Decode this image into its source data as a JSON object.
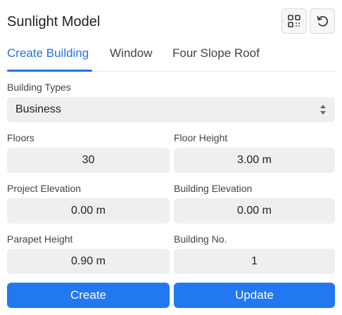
{
  "header": {
    "title": "Sunlight Model",
    "icons": [
      "qr-grid-icon",
      "reset-icon"
    ]
  },
  "tabs": [
    {
      "label": "Create Building",
      "active": true
    },
    {
      "label": "Window",
      "active": false
    },
    {
      "label": "Four Slope Roof",
      "active": false
    }
  ],
  "form": {
    "building_types": {
      "label": "Building Types",
      "value": "Business"
    },
    "floors": {
      "label": "Floors",
      "value": "30"
    },
    "floor_height": {
      "label": "Floor Height",
      "value": "3.00 m"
    },
    "project_elevation": {
      "label": "Project Elevation",
      "value": "0.00 m"
    },
    "building_elevation": {
      "label": "Building Elevation",
      "value": "0.00 m"
    },
    "parapet_height": {
      "label": "Parapet Height",
      "value": "0.90 m"
    },
    "building_no": {
      "label": "Building No.",
      "value": "1"
    }
  },
  "actions": {
    "create_label": "Create",
    "update_label": "Update"
  },
  "colors": {
    "accent": "#1e73e8",
    "button": "#2178f0",
    "field_bg": "#eeeff1"
  }
}
